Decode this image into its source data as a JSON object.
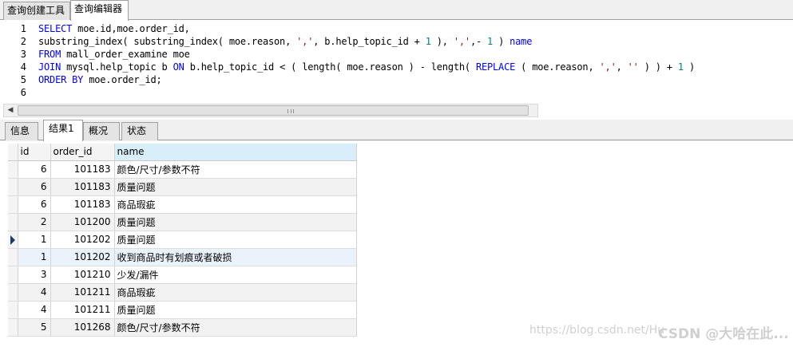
{
  "top_tabs": [
    "查询创建工具",
    "查询编辑器"
  ],
  "editor": {
    "line_numbers": [
      "1",
      "2",
      "3",
      "4",
      "5",
      "6"
    ],
    "lines": [
      [
        {
          "t": "SELECT",
          "c": "kw"
        },
        {
          "t": " moe.id,moe.order_id,",
          "c": ""
        }
      ],
      [
        {
          "t": "substring_index( substring_index( moe.reason, ",
          "c": ""
        },
        {
          "t": "','",
          "c": "str"
        },
        {
          "t": ", b.help_topic_id + ",
          "c": ""
        },
        {
          "t": "1",
          "c": "num"
        },
        {
          "t": " ), ",
          "c": ""
        },
        {
          "t": "','",
          "c": "str"
        },
        {
          "t": ",- ",
          "c": ""
        },
        {
          "t": "1",
          "c": "num"
        },
        {
          "t": " ) ",
          "c": ""
        },
        {
          "t": "name",
          "c": "kw"
        }
      ],
      [
        {
          "t": "FROM",
          "c": "kw"
        },
        {
          "t": " mall_order_examine moe",
          "c": ""
        }
      ],
      [
        {
          "t": "JOIN",
          "c": "kw"
        },
        {
          "t": " mysql.help_topic b ",
          "c": ""
        },
        {
          "t": "ON",
          "c": "kw"
        },
        {
          "t": " b.help_topic_id < ( length( moe.reason ) - length( ",
          "c": ""
        },
        {
          "t": "REPLACE",
          "c": "kw"
        },
        {
          "t": " ( moe.reason, ",
          "c": ""
        },
        {
          "t": "','",
          "c": "str"
        },
        {
          "t": ", ",
          "c": ""
        },
        {
          "t": "''",
          "c": "str"
        },
        {
          "t": " ) ) + ",
          "c": ""
        },
        {
          "t": "1",
          "c": "num"
        },
        {
          "t": " )",
          "c": ""
        }
      ],
      [
        {
          "t": "ORDER BY",
          "c": "kw"
        },
        {
          "t": " moe.order_id;",
          "c": ""
        }
      ],
      []
    ]
  },
  "scrollbar": {
    "left_arrow": "◀"
  },
  "result_tabs": [
    "信息",
    "结果1",
    "概况",
    "状态"
  ],
  "grid": {
    "columns": [
      "id",
      "order_id",
      "name"
    ],
    "rows": [
      [
        "6",
        "101183",
        "颜色/尺寸/参数不符"
      ],
      [
        "6",
        "101183",
        "质量问题"
      ],
      [
        "6",
        "101183",
        "商品瑕疵"
      ],
      [
        "2",
        "101200",
        "质量问题"
      ],
      [
        "1",
        "101202",
        "质量问题"
      ],
      [
        "1",
        "101202",
        "收到商品时有划痕或者破损"
      ],
      [
        "3",
        "101210",
        "少发/漏件"
      ],
      [
        "4",
        "101211",
        "商品瑕疵"
      ],
      [
        "4",
        "101211",
        "质量问题"
      ],
      [
        "5",
        "101268",
        "颜色/尺寸/参数不符"
      ]
    ],
    "current_row": 4
  },
  "watermark": {
    "url": "https://blog.csdn.net/Hu",
    "brand": "CSDN @大哈在此..."
  }
}
